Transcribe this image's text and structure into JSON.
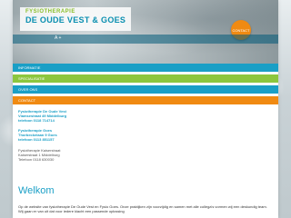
{
  "header": {
    "logo_top": "FYSIOTHERAPIE",
    "logo_bottom": "DE OUDE VEST & GOES",
    "contact_badge": "CONTACT",
    "lang_link": "A +"
  },
  "nav": {
    "items": [
      {
        "label": "INFORMATIE",
        "color": "#1a9fc6"
      },
      {
        "label": "SPECIALISATIE",
        "color": "#8cc63e"
      },
      {
        "label": "OVER ONS",
        "color": "#1a9fc6"
      },
      {
        "label": "CONTACT",
        "color": "#f08a12"
      }
    ]
  },
  "locations": [
    {
      "name": "Fysiotherapie De Oude Vest",
      "address": "Vlamsestraat 49 Middelburg",
      "phone": "telefoon 0118 714714"
    },
    {
      "name": "Fysiotherapie Goes",
      "address": "Thorbeckelaan 9 Goes",
      "phone": "telefoon 0113 851157"
    },
    {
      "name": "Fysiotherapie Kaiserstraat",
      "address": "Kaiserstraat 1 Middelburg",
      "phone": "Telefoon 0118 630030"
    }
  ],
  "main": {
    "heading": "Welkom",
    "intro": "Op de website van fysiotherapie De Oude Vest en Fysio Goes. Onze praktijken zijn voorzijdig en samen met alle collega's vormen wij een deskundig team. Wij gaan er van uit dat voor iedere klacht een passende oplossing"
  }
}
